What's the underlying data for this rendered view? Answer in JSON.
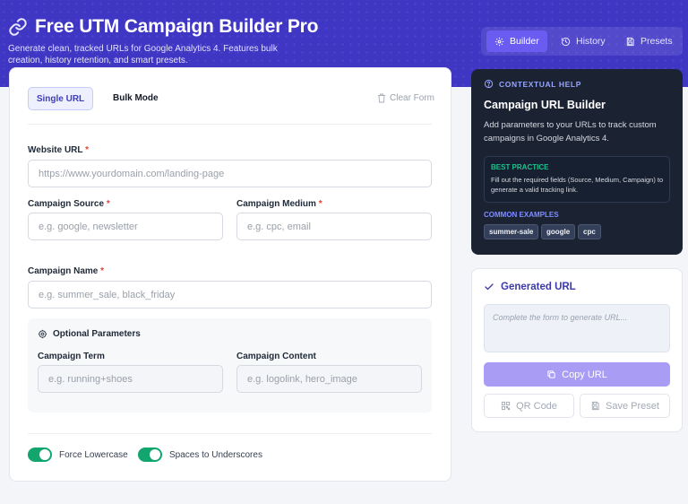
{
  "header": {
    "title": "Free UTM Campaign Builder Pro",
    "subtitle": "Generate clean, tracked URLs for Google Analytics 4. Features bulk creation, history retention, and smart presets."
  },
  "nav": {
    "builder": "Builder",
    "history": "History",
    "presets": "Presets"
  },
  "modes": {
    "single": "Single URL",
    "bulk": "Bulk Mode",
    "clear": "Clear Form"
  },
  "form": {
    "website_url": {
      "label": "Website URL",
      "required": "*",
      "placeholder": "https://www.yourdomain.com/landing-page",
      "value": ""
    },
    "source": {
      "label": "Campaign Source",
      "required": "*",
      "placeholder": "e.g. google, newsletter",
      "value": ""
    },
    "medium": {
      "label": "Campaign Medium",
      "required": "*",
      "placeholder": "e.g. cpc, email",
      "value": ""
    },
    "name": {
      "label": "Campaign Name",
      "required": "*",
      "placeholder": "e.g. summer_sale, black_friday",
      "value": ""
    },
    "optional": {
      "title": "Optional Parameters",
      "term": {
        "label": "Campaign Term",
        "placeholder": "e.g. running+shoes",
        "value": ""
      },
      "content": {
        "label": "Campaign Content",
        "placeholder": "e.g. logolink, hero_image",
        "value": ""
      }
    },
    "toggles": [
      {
        "label": "Force Lowercase",
        "on": true
      },
      {
        "label": "Spaces to Underscores",
        "on": true
      }
    ]
  },
  "help": {
    "heading": "CONTEXTUAL HELP",
    "title": "Campaign URL Builder",
    "body": "Add parameters to your URLs to track custom campaigns in Google Analytics 4.",
    "best_practice_heading": "BEST PRACTICE",
    "best_practice_text": "Fill out the required fields (Source, Medium, Campaign) to generate a valid tracking link.",
    "examples_heading": "COMMON EXAMPLES",
    "examples": [
      "summer-sale",
      "google",
      "cpc"
    ]
  },
  "generated": {
    "title": "Generated URL",
    "placeholder": "Complete the form to generate URL...",
    "copy": "Copy URL",
    "qr": "QR Code",
    "save": "Save Preset"
  },
  "colors": {
    "header_bg": "#3f36c4",
    "accent": "#6a5cf0",
    "toggle_on": "#12a66e",
    "help_bg": "#1b2232",
    "required": "#e0453a"
  },
  "icons": {
    "title": "link-icon",
    "builder": "gear-icon",
    "history": "history-icon",
    "presets": "save-icon",
    "clear": "trash-icon",
    "optional": "gear-icon",
    "help": "help-circle-icon",
    "generated": "check-icon",
    "copy": "copy-icon",
    "qr": "qr-code-icon",
    "save": "save-icon"
  }
}
